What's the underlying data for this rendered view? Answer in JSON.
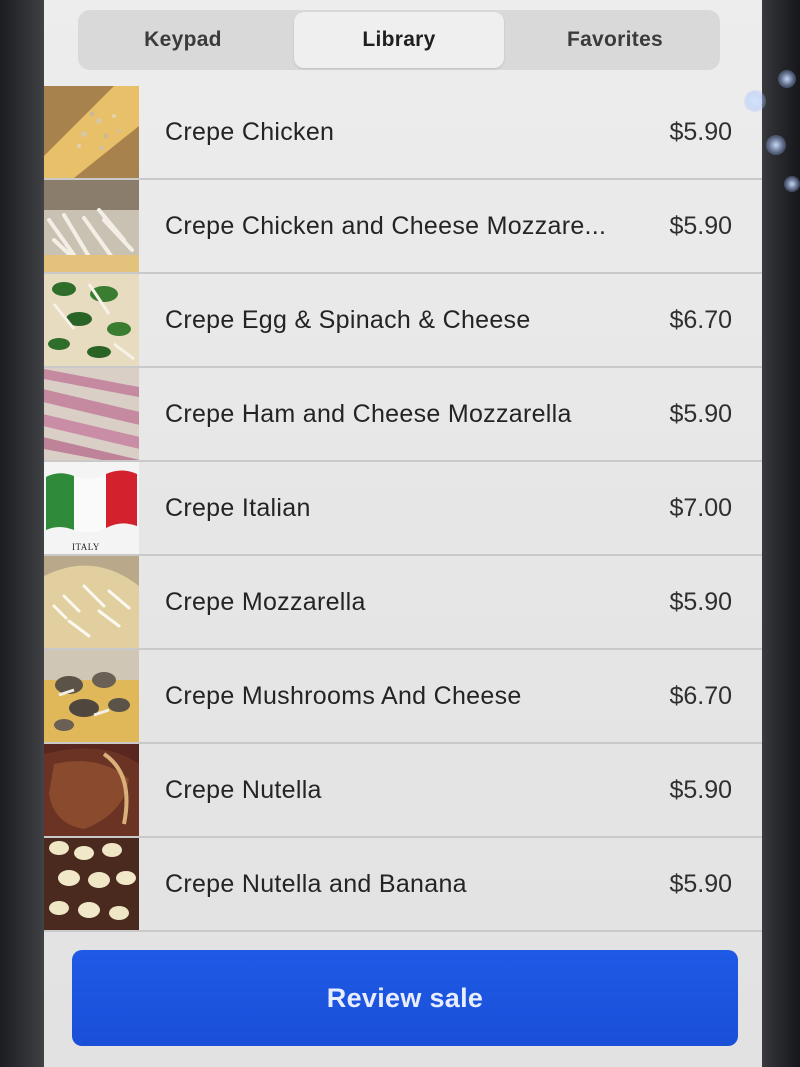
{
  "tabs": [
    {
      "label": "Keypad",
      "active": false
    },
    {
      "label": "Library",
      "active": true
    },
    {
      "label": "Favorites",
      "active": false
    }
  ],
  "items": [
    {
      "name": "Crepe Chicken",
      "price": "$5.90",
      "thumb": "crepe-chicken"
    },
    {
      "name": "Crepe Chicken and Cheese Mozzare...",
      "price": "$5.90",
      "thumb": "crepe-chicken-cheese"
    },
    {
      "name": "Crepe Egg & Spinach & Cheese",
      "price": "$6.70",
      "thumb": "crepe-egg-spinach"
    },
    {
      "name": "Crepe Ham and Cheese Mozzarella",
      "price": "$5.90",
      "thumb": "crepe-ham"
    },
    {
      "name": "Crepe Italian",
      "price": "$7.00",
      "thumb": "italy-flag",
      "caption": "ITALY"
    },
    {
      "name": "Crepe Mozzarella",
      "price": "$5.90",
      "thumb": "crepe-mozzarella"
    },
    {
      "name": "Crepe Mushrooms And Cheese",
      "price": "$6.70",
      "thumb": "crepe-mushrooms"
    },
    {
      "name": "Crepe Nutella",
      "price": "$5.90",
      "thumb": "crepe-nutella"
    },
    {
      "name": "Crepe Nutella and Banana",
      "price": "$5.90",
      "thumb": "crepe-nutella-banana"
    }
  ],
  "footer": {
    "review_label": "Review sale"
  },
  "colors": {
    "accent": "#1a4fd8",
    "text": "#242424",
    "divider": "#c9c9c9"
  }
}
